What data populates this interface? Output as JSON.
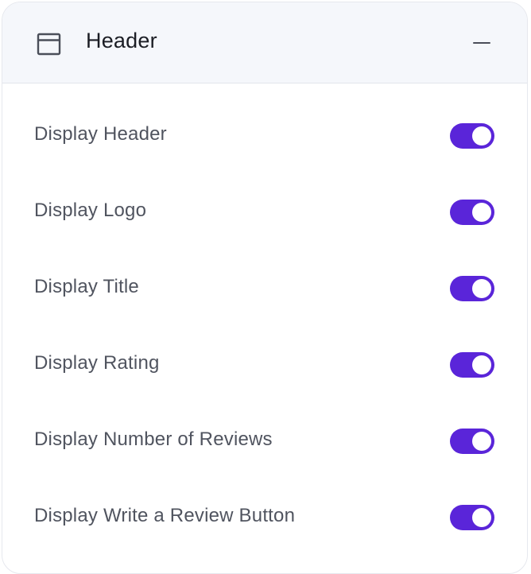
{
  "section": {
    "title": "Header",
    "icon": "layout-header-icon",
    "collapse_icon": "minus-icon"
  },
  "toggles": [
    {
      "label": "Display Header",
      "on": true
    },
    {
      "label": "Display Logo",
      "on": true
    },
    {
      "label": "Display Title",
      "on": true
    },
    {
      "label": "Display Rating",
      "on": true
    },
    {
      "label": "Display Number of Reviews",
      "on": true
    },
    {
      "label": "Display Write a Review Button",
      "on": true
    }
  ],
  "colors": {
    "toggle_on": "#5a25d9",
    "header_bg": "#f5f7fb"
  }
}
